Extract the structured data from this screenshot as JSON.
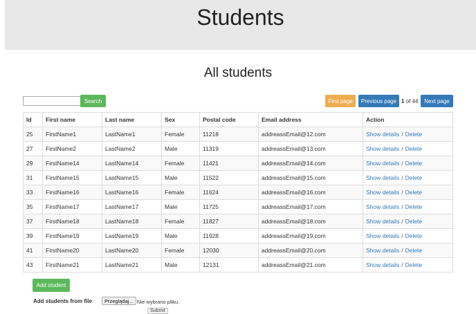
{
  "header": {
    "title": "Students"
  },
  "page": {
    "subtitle": "All students"
  },
  "search": {
    "value": "",
    "button": "Search"
  },
  "pagination": {
    "first": "First page",
    "previous": "Previous page",
    "current": "1",
    "of_label": "of 44",
    "next": "Next page"
  },
  "table": {
    "columns": [
      "Id",
      "First name",
      "Last name",
      "Sex",
      "Postal code",
      "Email address",
      "Action"
    ],
    "rows": [
      [
        "25",
        "FirstName1",
        "LastName1",
        "Female",
        "11218",
        "addreassEmail@12.com"
      ],
      [
        "27",
        "FirstName2",
        "LastName2",
        "Male",
        "11319",
        "addreassEmail@13.com"
      ],
      [
        "29",
        "FirstName14",
        "LastName14",
        "Female",
        "11421",
        "addreassEmail@14.com"
      ],
      [
        "31",
        "FirstName15",
        "LastName15",
        "Male",
        "11522",
        "addreassEmail@15.com"
      ],
      [
        "33",
        "FirstName16",
        "LastName16",
        "Female",
        "11624",
        "addreassEmail@16.com"
      ],
      [
        "35",
        "FirstName17",
        "LastName17",
        "Male",
        "11725",
        "addreassEmail@17.com"
      ],
      [
        "37",
        "FirstName18",
        "LastName18",
        "Female",
        "11827",
        "addreassEmail@18.com"
      ],
      [
        "39",
        "FirstName19",
        "LastName19",
        "Male",
        "11928",
        "addreassEmail@19.com"
      ],
      [
        "41",
        "FirstName20",
        "LastName20",
        "Female",
        "12030",
        "addreassEmail@20.com"
      ],
      [
        "43",
        "FirstName21",
        "LastName21",
        "Male",
        "12131",
        "addreassEmail@21.com"
      ]
    ],
    "action_details": "Show details",
    "action_separator": "/",
    "action_delete": "Delete"
  },
  "footer": {
    "add_student": "Add student",
    "file_label": "Add students from file",
    "browse_button": "Przeglądaj...",
    "file_status": "Nie wybrano pliku.",
    "submit": "Submit"
  },
  "colors": {
    "green": "#5cb85c",
    "orange": "#f0ad4e",
    "blue": "#337ab7",
    "header_bg": "#e8e8e8"
  }
}
